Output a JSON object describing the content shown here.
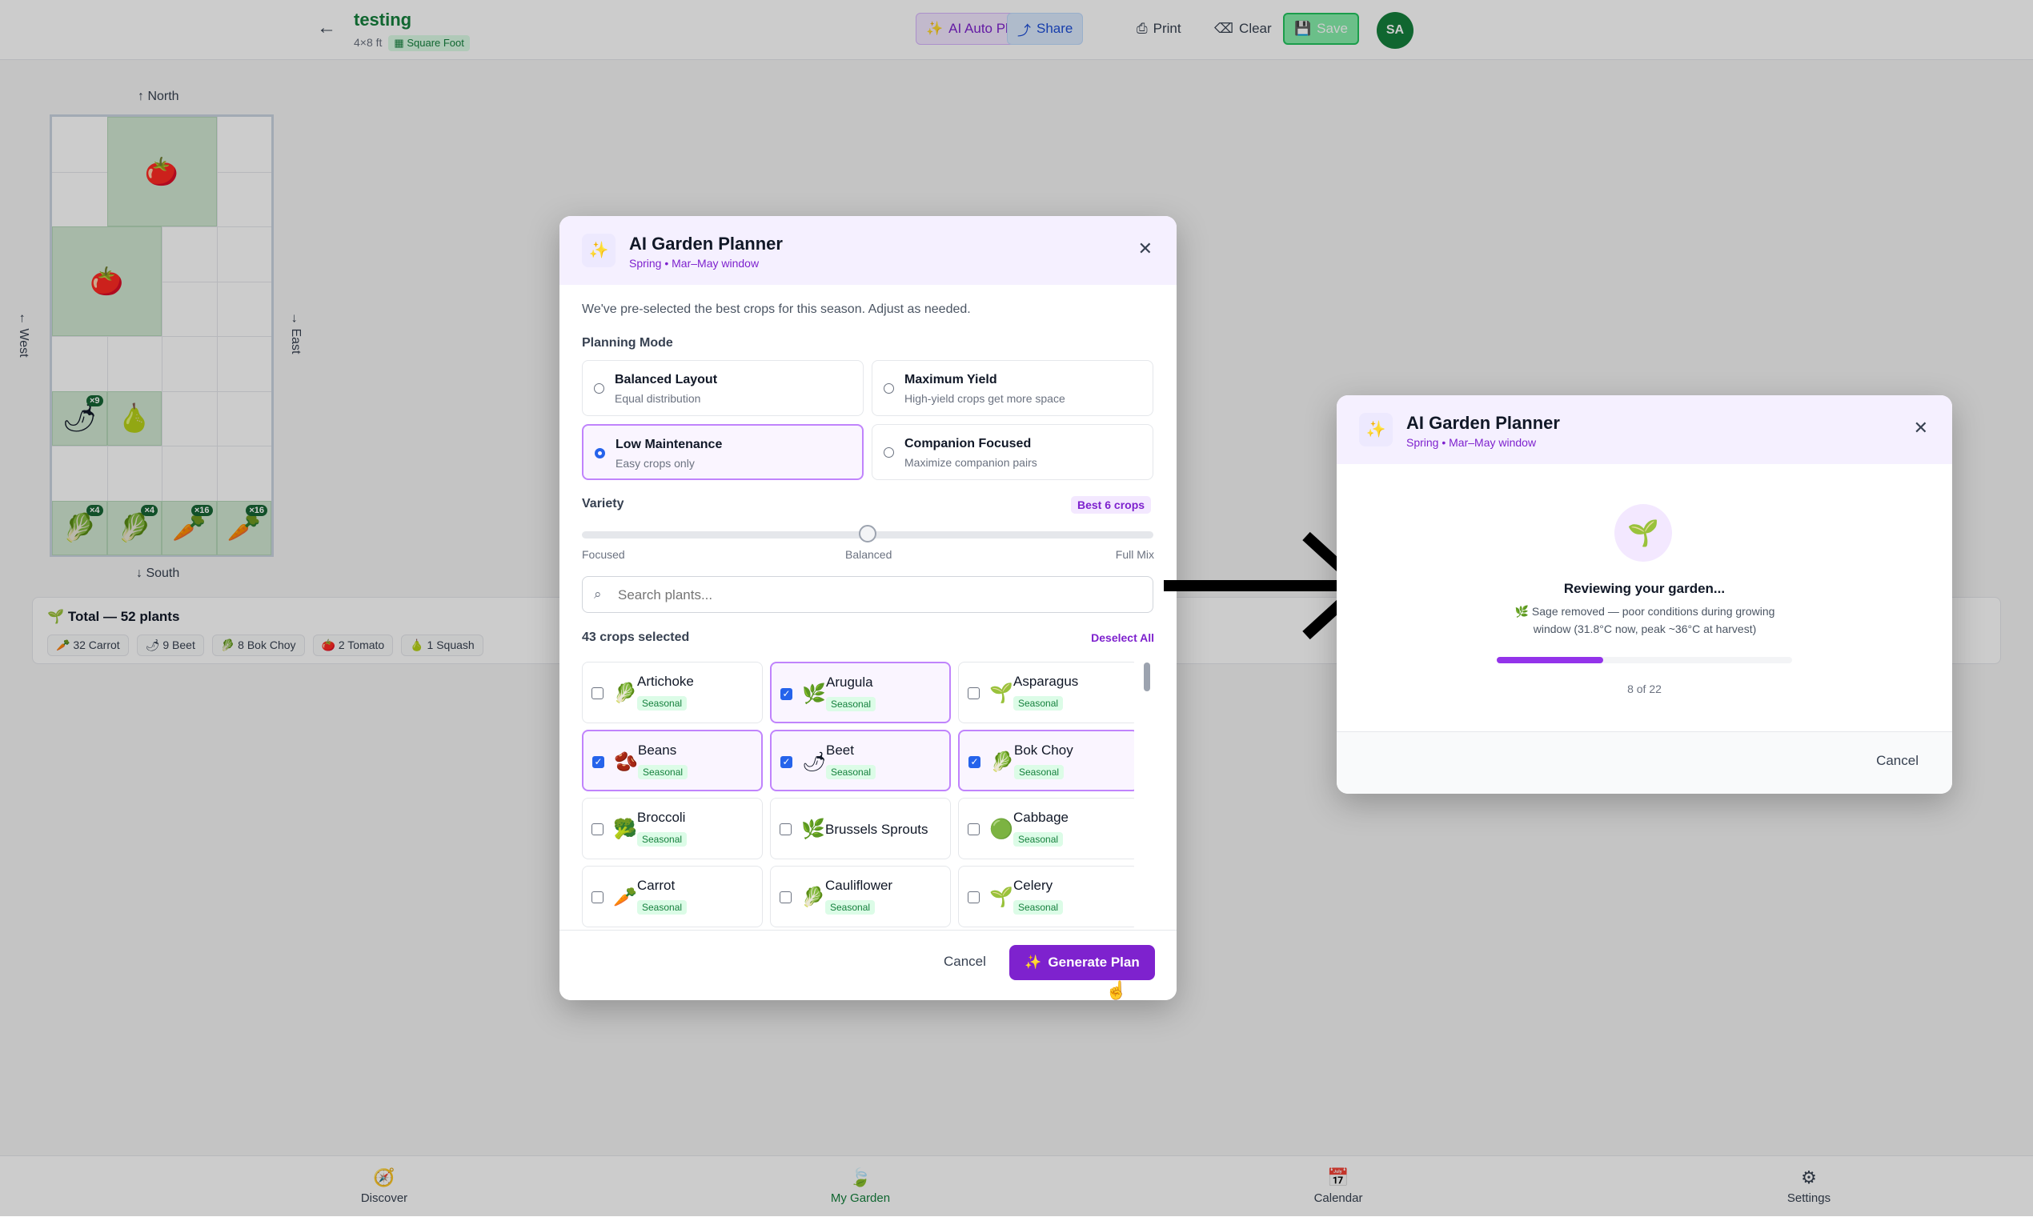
{
  "header": {
    "title": "testing",
    "size": "4×8 ft",
    "method_badge": "Square Foot",
    "buttons": {
      "auto_plan": "AI Auto Plan",
      "share": "Share",
      "print": "Print",
      "clear": "Clear",
      "save": "Save"
    },
    "avatar_initials": "SA"
  },
  "compass": {
    "north": "↑ North",
    "south": "↓ South",
    "west": "← West",
    "east": "→ East"
  },
  "grid_plants": [
    {
      "icon": "tomato-icon",
      "glyph": "🍅",
      "count": ""
    },
    {
      "icon": "tomato-icon",
      "glyph": "🍅",
      "count": ""
    },
    {
      "icon": "beet-icon",
      "glyph": "🌶",
      "count": "×9"
    },
    {
      "icon": "squash-icon",
      "glyph": "🍐",
      "count": ""
    },
    {
      "icon": "bok-choy-icon",
      "glyph": "🥬",
      "count": "×4"
    },
    {
      "icon": "bok-choy-icon",
      "glyph": "🥬",
      "count": "×4"
    },
    {
      "icon": "carrot-icon",
      "glyph": "🥕",
      "count": "×16"
    },
    {
      "icon": "carrot-icon",
      "glyph": "🥕",
      "count": "×16"
    }
  ],
  "totals": {
    "title": "Total — 52 plants",
    "chips": [
      "32 Carrot",
      "9 Beet",
      "8 Bok Choy",
      "2 Tomato",
      "1 Squash"
    ]
  },
  "bottom_nav": [
    {
      "label": "Discover",
      "icon": "compass-icon",
      "active": false
    },
    {
      "label": "My Garden",
      "icon": "leaf-icon",
      "active": true
    },
    {
      "label": "Calendar",
      "icon": "calendar-icon",
      "active": false
    },
    {
      "label": "Settings",
      "icon": "gear-icon",
      "active": false
    }
  ],
  "planner": {
    "title": "AI Garden Planner",
    "subtitle": "Spring • Mar–May window",
    "description": "We've pre-selected the best crops for this season. Adjust as needed.",
    "planning_mode_label": "Planning Mode",
    "modes": [
      {
        "name": "Balanced Layout",
        "desc": "Equal distribution",
        "selected": false
      },
      {
        "name": "Maximum Yield",
        "desc": "High-yield crops get more space",
        "selected": false
      },
      {
        "name": "Low Maintenance",
        "desc": "Easy crops only",
        "selected": true
      },
      {
        "name": "Companion Focused",
        "desc": "Maximize companion pairs",
        "selected": false
      }
    ],
    "variety": {
      "label": "Variety",
      "badge": "Best 6 crops",
      "level": 0.5,
      "stops": [
        "Focused",
        "Balanced",
        "Full Mix"
      ]
    },
    "search_placeholder": "Search plants...",
    "selected_count": "43 crops selected",
    "deselect_all": "Deselect All",
    "crops": [
      {
        "name": "Artichoke",
        "tag": "Seasonal",
        "checked": false,
        "icon": "artichoke-icon",
        "glyph": "🥬"
      },
      {
        "name": "Arugula",
        "tag": "Seasonal",
        "checked": true,
        "icon": "arugula-icon",
        "glyph": "🌿"
      },
      {
        "name": "Asparagus",
        "tag": "Seasonal",
        "checked": false,
        "icon": "asparagus-icon",
        "glyph": "🌱"
      },
      {
        "name": "Beans",
        "tag": "Seasonal",
        "checked": true,
        "icon": "beans-icon",
        "glyph": "🫘"
      },
      {
        "name": "Beet",
        "tag": "Seasonal",
        "checked": true,
        "icon": "beet-icon",
        "glyph": "🌶"
      },
      {
        "name": "Bok Choy",
        "tag": "Seasonal",
        "checked": true,
        "icon": "bok-choy-icon",
        "glyph": "🥬"
      },
      {
        "name": "Broccoli",
        "tag": "Seasonal",
        "checked": false,
        "icon": "broccoli-icon",
        "glyph": "🥦"
      },
      {
        "name": "Brussels Sprouts",
        "tag": "",
        "checked": false,
        "icon": "brussels-sprouts-icon",
        "glyph": "🌿"
      },
      {
        "name": "Cabbage",
        "tag": "Seasonal",
        "checked": false,
        "icon": "cabbage-icon",
        "glyph": "🟢"
      },
      {
        "name": "Carrot",
        "tag": "Seasonal",
        "checked": false,
        "icon": "carrot-icon",
        "glyph": "🥕"
      },
      {
        "name": "Cauliflower",
        "tag": "Seasonal",
        "checked": false,
        "icon": "cauliflower-icon",
        "glyph": "🥬"
      },
      {
        "name": "Celery",
        "tag": "Seasonal",
        "checked": false,
        "icon": "celery-icon",
        "glyph": "🌱"
      }
    ],
    "cancel": "Cancel",
    "generate": "Generate Plan"
  },
  "progress_dialog": {
    "title": "AI Garden Planner",
    "subtitle": "Spring • Mar–May window",
    "status": "Reviewing your garden...",
    "note_icon": "🌿",
    "note": "Sage removed — poor conditions during growing window (31.8°C now, peak ~36°C at harvest)",
    "progress": 0.36,
    "step": "8 of 22",
    "cancel": "Cancel"
  },
  "colors": {
    "accent_purple": "#7e22ce",
    "garden_green": "#15803d",
    "checkbox_blue": "#2563eb"
  }
}
